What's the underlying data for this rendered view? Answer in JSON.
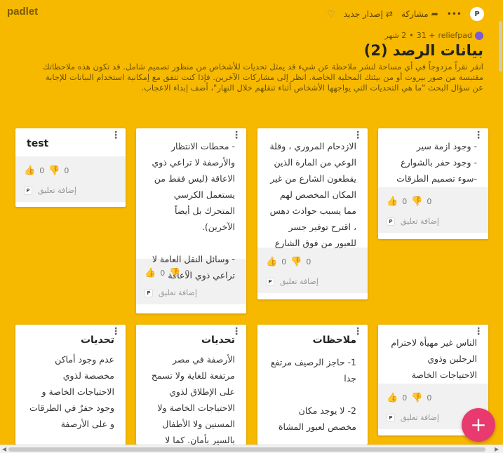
{
  "app": {
    "brand": "padlet",
    "avatar_text": "P"
  },
  "toolbar": {
    "more": "•••",
    "share_label": "مشاركة",
    "remake_label": "إصدار جديد"
  },
  "board": {
    "author": "reliefpad",
    "likes": "+ 31",
    "age": "2 شهر",
    "title": "بيانات الرصد (2)",
    "description": "انقر نقراً مزدوجاً في أي مساحة لنشر ملاحظة عن شيء قد يمثل تحديات للأشخاص من منظور تصميم شامل. قد تكون هذه ملاحظاتك مقتبسة من صور بيروت أو من بيئتك المحلية الخاصة. انظر إلى مشاركات الآخرين. فإذا كنت تتفق مع إمكانية استخدام البيانات للإجابة عن سؤال البحث \"ما هي التحديات التي يواجهها الأشخاص أثناء تنقلهم خلال النهار\"، أضف إبداء الاعجاب."
  },
  "common": {
    "comment_label": "إضافة تعليق",
    "like_count": "0",
    "dislike_count": "0"
  },
  "cards": [
    {
      "title": "test",
      "body": ""
    },
    {
      "title": "",
      "body": "- محطات الانتظار والأرصفة لا تراعي ذوي الاعاقة (ليس فقط من يستعمل الكرسي المتحرك بل أيضاً الآخرين).\n\n- وسائل النقل العامة لا تراعي ذوي الاعاقة"
    },
    {
      "title": "",
      "body": "الازدحام المروري ، وقلة الوعي من المارة الذين يقطعون الشارع من غير المكان المخصص لهم مما يسبب حوادث دهس ، اقترح توفير جسر للعبور من فوق الشارع"
    },
    {
      "title": "",
      "body": "- وجود ازمة سير\n- وجود حفر بالشوارع\n-سوء تصميم الطرقات"
    },
    {
      "title": "تحديات",
      "body": "عدم وجود أماكن مخصصة لذوي الاحتياجات الخاصة و وجود حفرٌ في الطرقات و على الأرصفة"
    },
    {
      "title": "تحديات",
      "body": "الأرصفة في مصر مرتفعة للغاية ولا تسمح على الإطلاق لذوي الاحتياجات الخاصة ولا المسنين ولا الأطفال بالسير بأمان. كما لا توجد أماكن مخصصة"
    },
    {
      "title": "ملاحظات",
      "body": "1-  حاجز الرصيف مرتفع جدا\n\n2-  لا يوجد مكان مخصص لعبور المشاة"
    },
    {
      "title": "",
      "body": "الناس غير مهيأة لاحترام الرجلين وذوي الاحتياجات الخاصة"
    }
  ],
  "fab_label": "+"
}
